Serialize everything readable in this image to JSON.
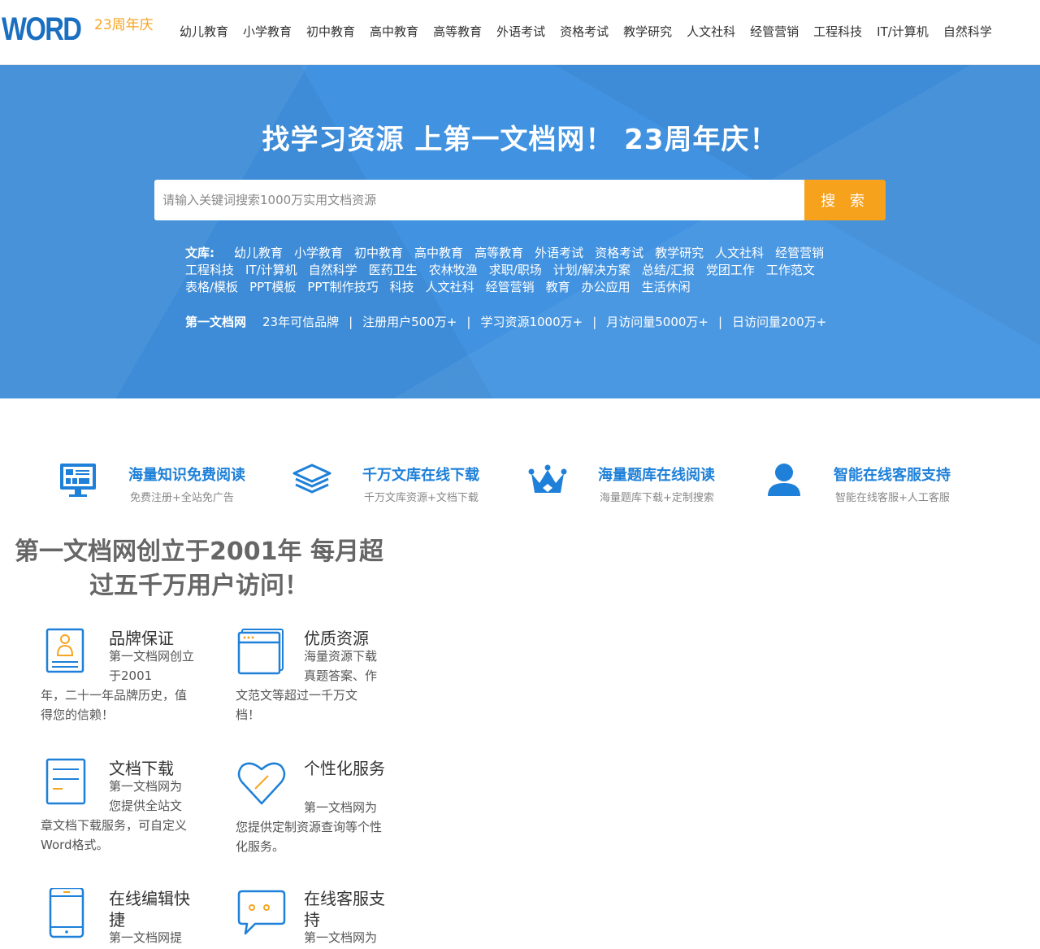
{
  "header": {
    "logo": "WORD",
    "anniversary": "23周年庆",
    "nav": [
      "幼儿教育",
      "小学教育",
      "初中教育",
      "高中教育",
      "高等教育",
      "外语考试",
      "资格考试",
      "教学研究",
      "人文社科",
      "经管营销",
      "工程科技",
      "IT/计算机",
      "自然科学"
    ]
  },
  "hero": {
    "title": "找学习资源 上第一文档网！ 23周年庆！",
    "search_placeholder": "请输入关键词搜索1000万实用文档资源",
    "search_button": "搜 索",
    "library_label": "文库:",
    "categories": [
      "幼儿教育",
      "小学教育",
      "初中教育",
      "高中教育",
      "高等教育",
      "外语考试",
      "资格考试",
      "教学研究",
      "人文社科",
      "经管营销",
      "工程科技",
      "IT/计算机",
      "自然科学",
      "医药卫生",
      "农林牧渔",
      "求职/职场",
      "计划/解决方案",
      "总结/汇报",
      "党团工作",
      "工作范文",
      "表格/模板",
      "PPT模板",
      "PPT制作技巧",
      "科技",
      "人文社科",
      "经管营销",
      "教育",
      "办公应用",
      "生活休闲"
    ],
    "stats_brand": "第一文档网",
    "stats": [
      "23年可信品牌",
      "注册用户500万+",
      "学习资源1000万+",
      "月访问量5000万+",
      "日访问量200万+"
    ],
    "stats_sep": "|"
  },
  "features": [
    {
      "icon": "monitor-icon",
      "title": "海量知识免费阅读",
      "sub": "免费注册+全站免广告"
    },
    {
      "icon": "layers-icon",
      "title": "千万文库在线下载",
      "sub": "千万文库资源+文档下载"
    },
    {
      "icon": "crown-icon",
      "title": "海量题库在线阅读",
      "sub": "海量题库下载+定制搜索"
    },
    {
      "icon": "user-icon",
      "title": "智能在线客服支持",
      "sub": "智能在线客服+人工客服"
    }
  ],
  "about": {
    "title": "第一文档网创立于2001年 每月超过五千万用户访问！",
    "cards": [
      {
        "icon": "badge-icon",
        "title": "品牌保证",
        "desc_a": "第一文档网创立于2001",
        "desc_b": "年，二十一年品牌历史，值得您的信赖！"
      },
      {
        "icon": "browser-icon",
        "title": "优质资源",
        "desc_a": "海量资源下载真题答案、作",
        "desc_b": "文范文等超过一千万文档！"
      },
      {
        "icon": "document-icon",
        "title": "文档下载",
        "desc_a": "第一文档网为您提供全站文",
        "desc_b": "章文档下载服务，可自定义Word格式。"
      },
      {
        "icon": "heart-icon",
        "title": "个性化服务",
        "desc_a": "第一文档网为",
        "desc_b": "您提供定制资源查询等个性化服务。"
      },
      {
        "icon": "phone-icon",
        "title": "在线编辑快捷",
        "desc_a": "第一文档网提",
        "desc_b": ""
      },
      {
        "icon": "chat-icon",
        "title": "在线客服支持",
        "desc_a": "第一文档网为",
        "desc_b": ""
      }
    ]
  },
  "colors": {
    "hero_bg": "#4192e0",
    "accent_orange": "#f7a21d",
    "feature_blue": "#1e80d8",
    "logo_blue": "#1b6fc0"
  }
}
